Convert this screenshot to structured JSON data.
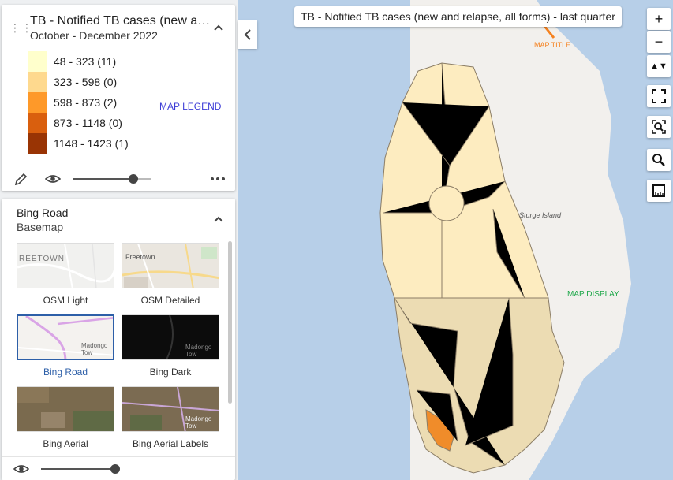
{
  "legend": {
    "title": "TB - Notified TB cases (new and relapse, all forms) - last quarter",
    "period": "October - December 2022",
    "items": [
      {
        "label": "48 - 323 (11)",
        "color": "#ffffcc"
      },
      {
        "label": "323 - 598 (0)",
        "color": "#fed98e"
      },
      {
        "label": "598 - 873 (2)",
        "color": "#fe9929"
      },
      {
        "label": "873 - 1148 (0)",
        "color": "#d95f0e"
      },
      {
        "label": "1148 - 1423 (1)",
        "color": "#993404"
      }
    ],
    "annotation": "MAP LEGEND",
    "opacity": 0.85
  },
  "basemap": {
    "title": "Bing Road",
    "subtitle": "Basemap",
    "tiles": [
      {
        "label": "OSM Light",
        "thumb_text": "REETOWN"
      },
      {
        "label": "OSM Detailed",
        "thumb_text": "Freetown"
      },
      {
        "label": "Bing Road",
        "thumb_text": "Madongo Tow"
      },
      {
        "label": "Bing Dark",
        "thumb_text": "Madongo Tow"
      },
      {
        "label": "Bing Aerial",
        "thumb_text": ""
      },
      {
        "label": "Bing Aerial Labels",
        "thumb_text": "Madongo Tow"
      }
    ],
    "selected": "Bing Road",
    "opacity": 1.0
  },
  "map": {
    "title": "TB - Notified TB cases (new and relapse, all forms) - last quarter",
    "title_annotation": "MAP TITLE",
    "display_annotation": "MAP DISPLAY",
    "place_label": "Sturge Island"
  },
  "controls": {
    "zoom_in": "+",
    "zoom_out": "−",
    "compass": "▲▼"
  },
  "colors": {
    "annotation_blue": "#3b3bd6",
    "annotation_orange": "#f58220",
    "annotation_green": "#1fa84a",
    "selected": "#2d5fa8"
  }
}
